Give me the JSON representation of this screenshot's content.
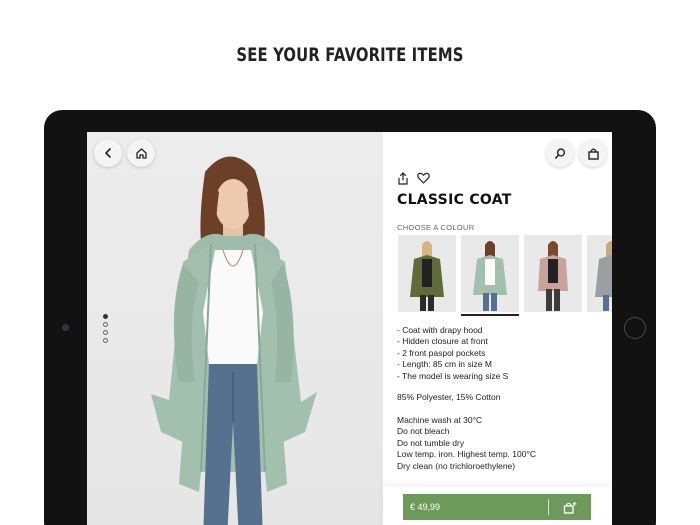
{
  "headline": "SEE YOUR FAVORITE ITEMS",
  "nav": {
    "back_icon": "chevron-left-icon",
    "home_icon": "home-icon",
    "search_icon": "search-icon",
    "bag_icon": "shopping-bag-icon"
  },
  "gallery": {
    "image_count": 4,
    "active_index": 0
  },
  "product": {
    "share_icon": "share-icon",
    "favorite_icon": "heart-icon",
    "title": "CLASSIC COAT",
    "colour_label": "CHOOSE A COLOUR",
    "colours": [
      {
        "name": "olive",
        "hex": "#5f6b3a",
        "selected": false
      },
      {
        "name": "mint",
        "hex": "#a3bfae",
        "selected": true
      },
      {
        "name": "rose",
        "hex": "#c9a39b",
        "selected": false
      },
      {
        "name": "grey",
        "hex": "#9a9fa3",
        "selected": false
      }
    ],
    "description": [
      "- Coat with drapy hood",
      "- Hidden closure at front",
      "- 2 front paspol pockets",
      "- Length: 85 cm in size M",
      "- The model is wearing size S"
    ],
    "material": "85% Polyester, 15% Cotton",
    "care": [
      "Machine wash at 30°C",
      "Do not bleach",
      "Do not tumble dry",
      "Low temp. iron. Highest temp. 100°C",
      "Dry clean (no trichloroethylene)"
    ],
    "price": "€ 49,99",
    "add_to_bag_icon": "bag-plus-icon"
  },
  "colors": {
    "accent_green": "#6d9a5b",
    "coat_mint": "#a3bfae"
  }
}
